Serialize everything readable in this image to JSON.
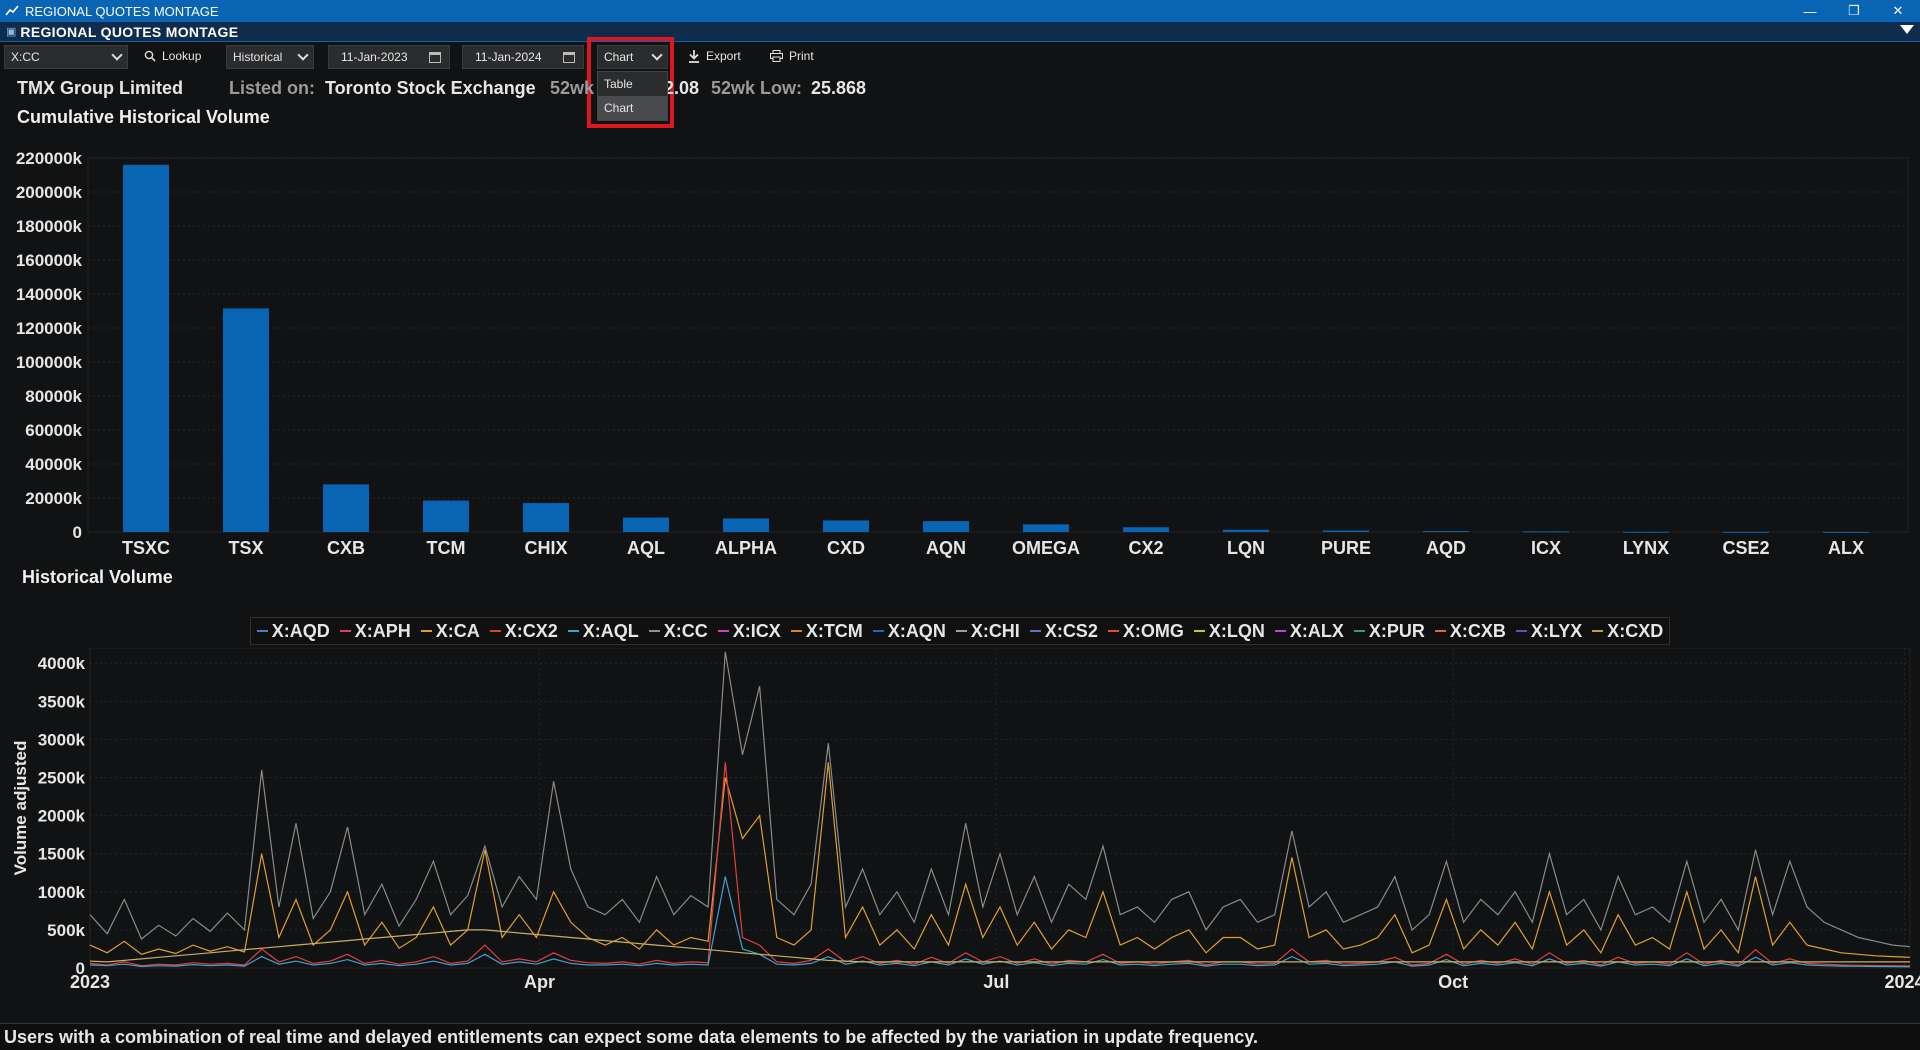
{
  "window": {
    "title": "REGIONAL QUOTES MONTAGE",
    "min_icon": "minimize-icon",
    "max_icon": "restore-icon",
    "close_icon": "close-icon"
  },
  "panel": {
    "title": "REGIONAL QUOTES MONTAGE"
  },
  "toolbar": {
    "symbol": "X:CC",
    "lookup_label": "Lookup",
    "mode": "Historical",
    "start_date": "11-Jan-2023",
    "end_date": "11-Jan-2024",
    "view_select": "Chart",
    "view_options": [
      "Table",
      "Chart"
    ],
    "export_label": "Export",
    "print_label": "Print"
  },
  "info": {
    "company": "TMX Group Limited",
    "listed_label": "Listed on:",
    "exchange": "Toronto Stock Exchange",
    "wk52_high_label_fragment": "52wk",
    "wk52_high_value_fragment": "2.08",
    "wk52_low_label": "52wk Low:",
    "wk52_low_value": "25.868"
  },
  "footer": {
    "text": "Users with a combination of real time and delayed entitlements can expect some data elements to be affected by the variation in update frequency."
  },
  "chart_data": [
    {
      "type": "bar",
      "title": "Cumulative Historical Volume",
      "categories": [
        "TSXC",
        "TSX",
        "CXB",
        "TCM",
        "CHIX",
        "AQL",
        "ALPHA",
        "CXD",
        "AQN",
        "OMEGA",
        "CX2",
        "LQN",
        "PURE",
        "AQD",
        "ICX",
        "LYNX",
        "CSE2",
        "ALX"
      ],
      "values": [
        216000,
        131500,
        28000,
        18500,
        17000,
        8500,
        8000,
        6800,
        6400,
        4500,
        2800,
        1300,
        900,
        600,
        400,
        150,
        80,
        40
      ],
      "ylim": [
        0,
        220000
      ],
      "yticks": [
        "0",
        "20000k",
        "40000k",
        "60000k",
        "80000k",
        "100000k",
        "120000k",
        "140000k",
        "160000k",
        "180000k",
        "200000k",
        "220000k"
      ],
      "color": "#0a64b4"
    },
    {
      "type": "line",
      "title": "Historical Volume",
      "ylabel": "Volume adjusted",
      "ylim": [
        0,
        4200
      ],
      "yticks": [
        "0",
        "500k",
        "1000k",
        "1500k",
        "2000k",
        "2500k",
        "3000k",
        "3500k",
        "4000k"
      ],
      "xticks": [
        "2023",
        "Apr",
        "Jul",
        "Oct",
        "2024"
      ],
      "legend": [
        {
          "name": "X:AQD",
          "color": "#4a7fd0"
        },
        {
          "name": "X:APH",
          "color": "#e04060"
        },
        {
          "name": "X:CA",
          "color": "#e0a030"
        },
        {
          "name": "X:CX2",
          "color": "#e04040"
        },
        {
          "name": "X:AQL",
          "color": "#40a0d0"
        },
        {
          "name": "X:CC",
          "color": "#909090"
        },
        {
          "name": "X:ICX",
          "color": "#d040c0"
        },
        {
          "name": "X:TCM",
          "color": "#e08030"
        },
        {
          "name": "X:AQN",
          "color": "#3060c0"
        },
        {
          "name": "X:CHI",
          "color": "#a0a0a0"
        },
        {
          "name": "X:CS2",
          "color": "#6070d0"
        },
        {
          "name": "X:OMG",
          "color": "#e05030"
        },
        {
          "name": "X:LQN",
          "color": "#d0c040"
        },
        {
          "name": "X:ALX",
          "color": "#c040e0"
        },
        {
          "name": "X:PUR",
          "color": "#30a070"
        },
        {
          "name": "X:CXB",
          "color": "#e06060"
        },
        {
          "name": "X:LYX",
          "color": "#6050c0"
        },
        {
          "name": "X:CXD",
          "color": "#c0a040"
        }
      ],
      "series": [
        {
          "name": "X:CC",
          "color": "#8a8a8a",
          "values": [
            700,
            450,
            900,
            380,
            560,
            420,
            650,
            480,
            720,
            500,
            2600,
            800,
            1900,
            650,
            1000,
            1850,
            700,
            1100,
            550,
            900,
            1400,
            700,
            950,
            1600,
            800,
            1200,
            900,
            2450,
            1300,
            800,
            700,
            900,
            600,
            1200,
            700,
            950,
            800,
            4150,
            2800,
            3700,
            900,
            700,
            1100,
            2950,
            800,
            1300,
            700,
            1000,
            600,
            1300,
            700,
            1900,
            800,
            1500,
            700,
            1200,
            600,
            1100,
            900,
            1600,
            700,
            800,
            600,
            900,
            1000,
            500,
            800,
            900,
            600,
            700,
            1800,
            800,
            1000,
            600,
            700,
            800,
            1200,
            500,
            700,
            1400,
            600,
            900,
            700,
            1000,
            600,
            1500,
            700,
            900,
            500,
            1200,
            700,
            800,
            600,
            1400,
            600,
            900,
            500,
            1550,
            700,
            1400,
            800,
            600,
            500,
            400,
            350,
            300,
            280
          ]
        },
        {
          "name": "X:CA",
          "color": "#e0a030",
          "values": [
            300,
            200,
            350,
            180,
            250,
            190,
            300,
            220,
            280,
            210,
            1500,
            400,
            900,
            300,
            500,
            1000,
            300,
            600,
            260,
            400,
            800,
            300,
            500,
            1550,
            400,
            700,
            400,
            1000,
            600,
            400,
            300,
            400,
            250,
            500,
            300,
            400,
            350,
            2500,
            1700,
            2000,
            400,
            300,
            500,
            2700,
            400,
            800,
            300,
            500,
            250,
            700,
            300,
            1100,
            400,
            800,
            300,
            600,
            250,
            500,
            400,
            1000,
            300,
            400,
            250,
            400,
            500,
            200,
            400,
            400,
            250,
            300,
            1450,
            400,
            500,
            250,
            300,
            400,
            700,
            200,
            300,
            900,
            250,
            500,
            300,
            600,
            250,
            1000,
            300,
            500,
            200,
            700,
            300,
            400,
            250,
            1000,
            250,
            500,
            200,
            1200,
            300,
            600,
            300,
            250,
            200,
            180,
            160,
            150,
            140
          ]
        },
        {
          "name": "X:TCM",
          "color": "#e04040",
          "values": [
            60,
            40,
            80,
            30,
            50,
            40,
            70,
            50,
            60,
            40,
            250,
            80,
            150,
            60,
            90,
            180,
            60,
            100,
            50,
            80,
            150,
            60,
            90,
            300,
            80,
            120,
            80,
            200,
            100,
            70,
            60,
            80,
            50,
            100,
            60,
            80,
            70,
            2700,
            400,
            300,
            80,
            60,
            100,
            250,
            80,
            150,
            60,
            100,
            50,
            140,
            60,
            200,
            80,
            150,
            60,
            120,
            50,
            100,
            80,
            180,
            60,
            80,
            50,
            80,
            100,
            40,
            80,
            80,
            50,
            60,
            250,
            80,
            100,
            50,
            60,
            80,
            140,
            40,
            60,
            180,
            50,
            100,
            60,
            120,
            50,
            200,
            60,
            100,
            40,
            140,
            60,
            80,
            50,
            200,
            50,
            100,
            40,
            240,
            60,
            120,
            60,
            50,
            40,
            36,
            32,
            30,
            28
          ]
        },
        {
          "name": "X:AQL",
          "color": "#40a0d0",
          "values": [
            40,
            30,
            50,
            20,
            30,
            25,
            45,
            30,
            40,
            25,
            150,
            50,
            90,
            40,
            60,
            110,
            40,
            60,
            30,
            50,
            90,
            40,
            60,
            180,
            50,
            80,
            50,
            120,
            60,
            40,
            40,
            50,
            30,
            60,
            40,
            50,
            40,
            1200,
            250,
            180,
            50,
            40,
            60,
            150,
            50,
            90,
            40,
            60,
            30,
            80,
            40,
            120,
            50,
            90,
            40,
            70,
            30,
            60,
            50,
            110,
            40,
            50,
            30,
            50,
            60,
            25,
            50,
            50,
            30,
            40,
            150,
            50,
            60,
            30,
            40,
            50,
            80,
            25,
            40,
            110,
            30,
            60,
            40,
            70,
            30,
            120,
            40,
            60,
            25,
            80,
            40,
            50,
            30,
            120,
            30,
            60,
            25,
            140,
            40,
            70,
            40,
            30,
            25,
            22,
            20,
            18,
            16
          ]
        },
        {
          "name": "X:CHI",
          "color": "#c8b060",
          "values": [
            90,
            80,
            100,
            120,
            140,
            160,
            180,
            200,
            220,
            240,
            260,
            280,
            300,
            320,
            340,
            360,
            380,
            400,
            420,
            440,
            460,
            480,
            500,
            500,
            480,
            460,
            440,
            420,
            400,
            380,
            360,
            340,
            320,
            300,
            280,
            260,
            240,
            220,
            200,
            180,
            160,
            140,
            120,
            100,
            90,
            80,
            80,
            80,
            80,
            80,
            80,
            80,
            80,
            80,
            80,
            80,
            80,
            80,
            80,
            80,
            80,
            80,
            80,
            80,
            80,
            80,
            80,
            80,
            80,
            80,
            80,
            80,
            80,
            80,
            80,
            80,
            80,
            80,
            80,
            80,
            80,
            80,
            80,
            80,
            80,
            80,
            80,
            80,
            80,
            80,
            80,
            80,
            80,
            80,
            80,
            80,
            80,
            80,
            80,
            80,
            80,
            80,
            80,
            80,
            80,
            80,
            80
          ]
        }
      ]
    }
  ]
}
